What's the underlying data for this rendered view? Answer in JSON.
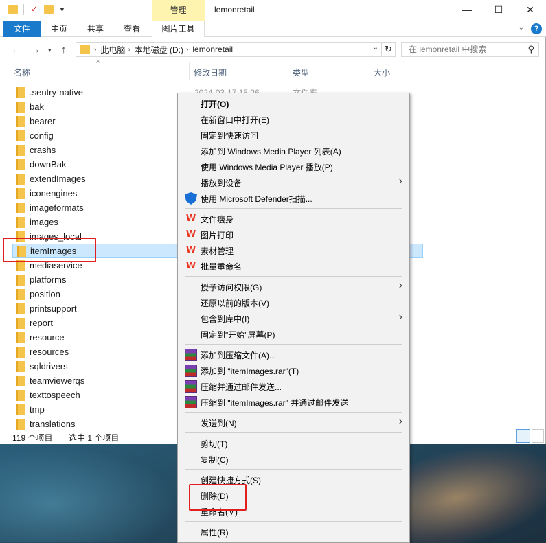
{
  "title_bar": {
    "manage_tab": "管理",
    "window_title": "lemonretail",
    "minimize": "—",
    "maximize": "☐",
    "close": "✕"
  },
  "ribbon": {
    "file": "文件",
    "tabs": [
      "主页",
      "共享",
      "查看",
      "图片工具"
    ]
  },
  "address": {
    "crumbs": [
      "此电脑",
      "本地磁盘 (D:)",
      "lemonretail"
    ],
    "search_placeholder": "在 lemonretail 中搜索"
  },
  "columns": {
    "name": "名称",
    "date": "修改日期",
    "type": "类型",
    "size": "大小"
  },
  "files": [
    {
      "name": ".sentry-native",
      "date": "2024-03-17 15:26",
      "type": "文件夹"
    },
    {
      "name": "bak"
    },
    {
      "name": "bearer"
    },
    {
      "name": "config"
    },
    {
      "name": "crashs"
    },
    {
      "name": "downBak"
    },
    {
      "name": "extendImages"
    },
    {
      "name": "iconengines"
    },
    {
      "name": "imageformats"
    },
    {
      "name": "images"
    },
    {
      "name": "images_local"
    },
    {
      "name": "itemImages",
      "selected": true
    },
    {
      "name": "mediaservice"
    },
    {
      "name": "platforms"
    },
    {
      "name": "position"
    },
    {
      "name": "printsupport"
    },
    {
      "name": "report"
    },
    {
      "name": "resource"
    },
    {
      "name": "resources"
    },
    {
      "name": "sqldrivers"
    },
    {
      "name": "teamviewerqs"
    },
    {
      "name": "texttospeech"
    },
    {
      "name": "tmp"
    },
    {
      "name": "translations"
    }
  ],
  "status": {
    "count": "119 个项目",
    "selected": "选中 1 个项目"
  },
  "context_menu": {
    "open": "打开(O)",
    "open_new_window": "在新窗口中打开(E)",
    "pin_quick": "固定到快速访问",
    "wmp_add": "添加到 Windows Media Player 列表(A)",
    "wmp_play": "使用 Windows Media Player 播放(P)",
    "cast": "播放到设备",
    "defender": "使用 Microsoft Defender扫描...",
    "wps_slim": "文件瘦身",
    "wps_print": "图片打印",
    "wps_assets": "素材管理",
    "wps_rename": "批量重命名",
    "give_access": "授予访问权限(G)",
    "restore": "还原以前的版本(V)",
    "include_lib": "包含到库中(I)",
    "pin_start": "固定到\"开始\"屏幕(P)",
    "rar_add": "添加到压缩文件(A)...",
    "rar_add_named": "添加到 \"itemImages.rar\"(T)",
    "rar_email": "压缩并通过邮件发送...",
    "rar_email_named": "压缩到 \"itemImages.rar\" 并通过邮件发送",
    "send_to": "发送到(N)",
    "cut": "剪切(T)",
    "copy": "复制(C)",
    "shortcut": "创建快捷方式(S)",
    "delete": "删除(D)",
    "rename": "重命名(M)",
    "properties": "属性(R)"
  },
  "icons": {
    "wps": "W",
    "arrow": "›"
  }
}
